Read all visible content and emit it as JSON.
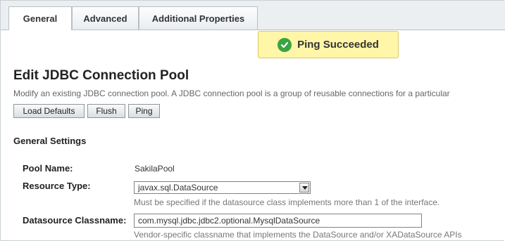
{
  "tabs": [
    {
      "label": "General",
      "active": true
    },
    {
      "label": "Advanced",
      "active": false
    },
    {
      "label": "Additional Properties",
      "active": false
    }
  ],
  "ping_banner": {
    "text": "Ping Succeeded",
    "icon": "checkmark-circle-icon",
    "color": "#3aa441"
  },
  "page_title": "Edit JDBC Connection Pool",
  "description": "Modify an existing JDBC connection pool. A JDBC connection pool is a group of reusable connections for a particular",
  "buttons": {
    "load_defaults": "Load Defaults",
    "flush": "Flush",
    "ping": "Ping"
  },
  "section_title": "General Settings",
  "fields": {
    "pool_name": {
      "label": "Pool Name:",
      "value": "SakilaPool"
    },
    "resource_type": {
      "label": "Resource Type:",
      "value": "javax.sql.DataSource",
      "help": "Must be specified if the datasource class implements more than 1 of the interface."
    },
    "datasource_classname": {
      "label": "Datasource Classname:",
      "value": "com.mysql.jdbc.jdbc2.optional.MysqlDataSource",
      "help": "Vendor-specific classname that implements the DataSource and/or XADataSource APIs"
    }
  }
}
